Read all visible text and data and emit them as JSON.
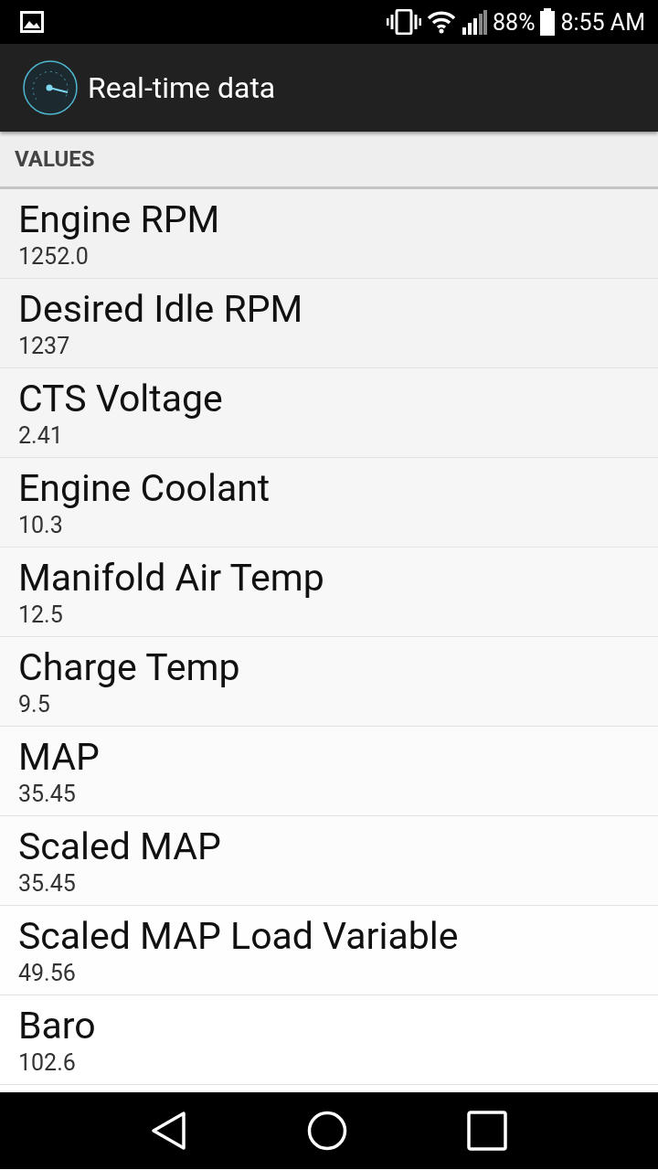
{
  "status_bar": {
    "battery": "88%",
    "time": "8:55 AM"
  },
  "app_bar": {
    "title": "Real-time data"
  },
  "section": {
    "title": "VALUES"
  },
  "rows": [
    {
      "name": "Engine RPM",
      "value": "1252.0"
    },
    {
      "name": "Desired Idle RPM",
      "value": "1237"
    },
    {
      "name": "CTS Voltage",
      "value": "2.41"
    },
    {
      "name": "Engine Coolant",
      "value": "10.3"
    },
    {
      "name": "Manifold Air Temp",
      "value": "12.5"
    },
    {
      "name": "Charge Temp",
      "value": "9.5"
    },
    {
      "name": "MAP",
      "value": "35.45"
    },
    {
      "name": "Scaled MAP",
      "value": "35.45"
    },
    {
      "name": "Scaled MAP Load Variable",
      "value": "49.56"
    },
    {
      "name": "Baro",
      "value": "102.6"
    }
  ]
}
